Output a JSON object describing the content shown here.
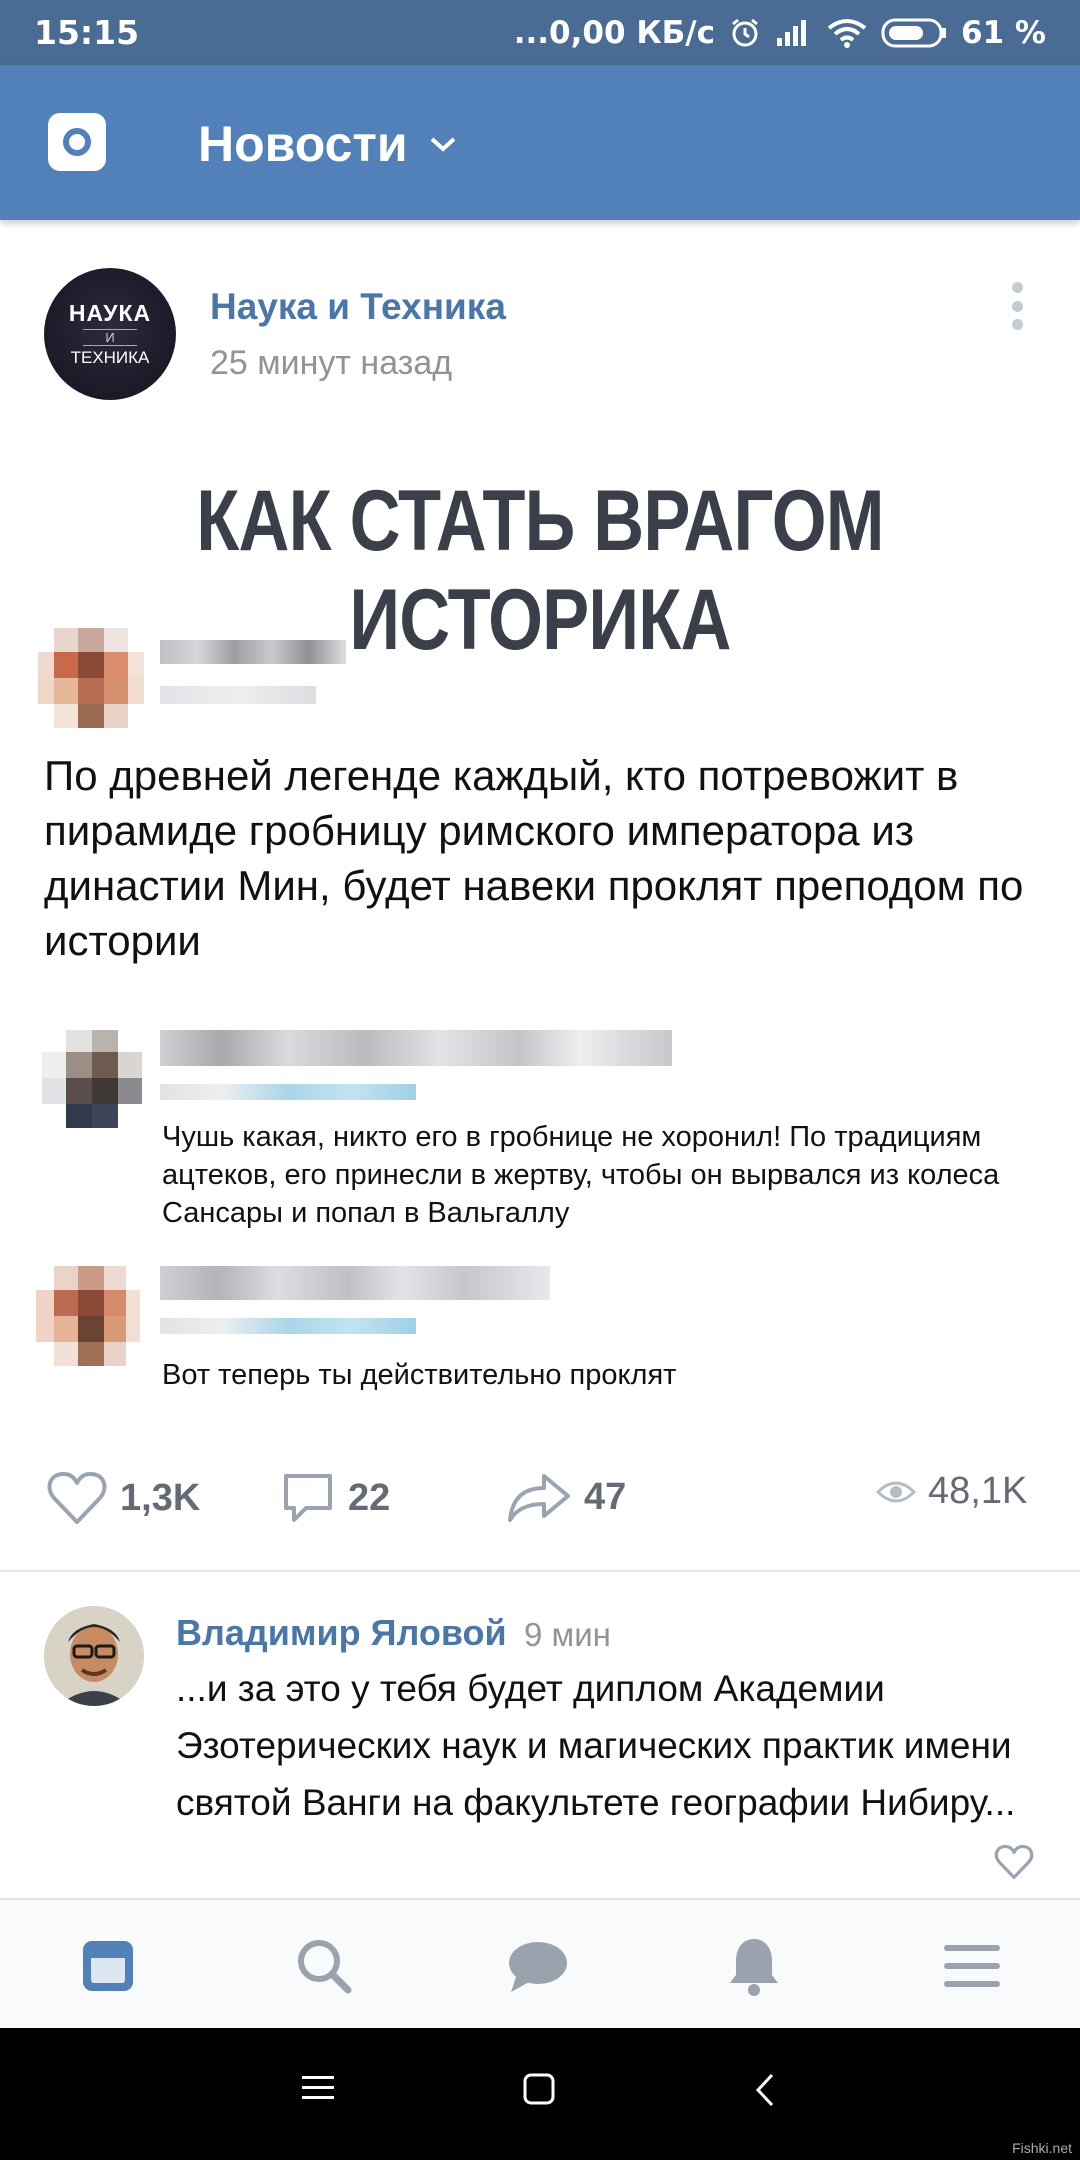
{
  "status_bar": {
    "time": "15:15",
    "network_speed": "...0,00 КБ/с",
    "battery": "61 %"
  },
  "header": {
    "title": "Новости"
  },
  "post": {
    "author": "Наука и Техника",
    "time": "25 минут назад",
    "avatar_lines": [
      "НАУКА",
      "И",
      "ТЕХНИКА"
    ],
    "meme": {
      "title": "КАК СТАТЬ ВРАГОМ ИСТОРИКА",
      "main_text": "По древней легенде каждый, кто потревожит в пирамиде гробницу римского императора из династии Мин, будет навеки проклят преподом по истории",
      "comments": [
        {
          "text": "Чушь какая, никто его в гробнице не хоронил! По традициям ацтеков, его принесли в жертву, чтобы он вырвался из колеса Сансары и попал в Вальгаллу"
        },
        {
          "text": "Вот теперь ты действительно проклят"
        }
      ]
    },
    "likes": "1,3K",
    "comments_count": "22",
    "shares": "47",
    "views": "48,1K"
  },
  "comment": {
    "author": "Владимир Яловой",
    "time": "9 мин",
    "text": "...и за это у тебя будет диплом Академии Эзотерических наук и магических практик имени святой Ванги на факультете географии Нибиру..."
  },
  "bottom_nav": {
    "items": [
      "news-icon",
      "search-icon",
      "messages-icon",
      "notifications-icon",
      "menu-icon"
    ],
    "active": "news-icon"
  },
  "colors": {
    "header": "#5181b8",
    "status_bar": "#4a6b93",
    "link": "#4a76a8",
    "muted": "#939393"
  },
  "watermark": "Fishki.net"
}
